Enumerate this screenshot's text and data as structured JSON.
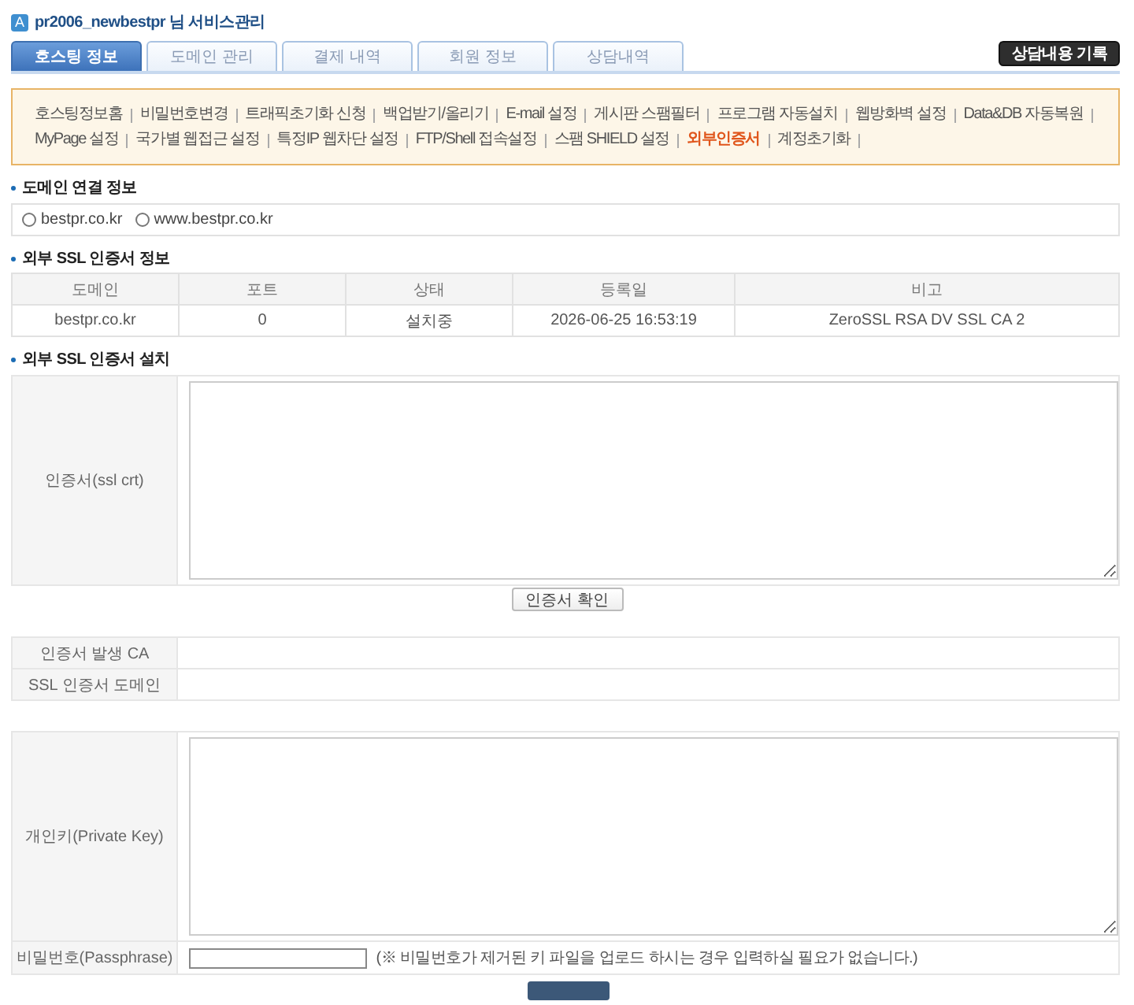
{
  "header": {
    "badge": "A",
    "title": "pr2006_newbestpr 님 서비스관리"
  },
  "tabs": [
    {
      "label": "호스팅 정보",
      "selected": true
    },
    {
      "label": "도메인 관리",
      "selected": false
    },
    {
      "label": "결제 내역",
      "selected": false
    },
    {
      "label": "회원 정보",
      "selected": false
    },
    {
      "label": "상담내역",
      "selected": false
    }
  ],
  "record_button": "상담내용 기록",
  "menu_links": [
    {
      "label": "호스팅정보홈",
      "selected": false
    },
    {
      "label": "비밀번호변경",
      "selected": false
    },
    {
      "label": "트래픽초기화 신청",
      "selected": false
    },
    {
      "label": "백업받기/올리기",
      "selected": false
    },
    {
      "label": "E-mail 설정",
      "selected": false
    },
    {
      "label": "게시판 스팸필터",
      "selected": false
    },
    {
      "label": "프로그램 자동설치",
      "selected": false
    },
    {
      "label": "웹방화벽 설정",
      "selected": false
    },
    {
      "label": "Data&DB 자동복원",
      "selected": false
    },
    {
      "label": "MyPage 설정",
      "selected": false
    },
    {
      "label": "국가별 웹접근 설정",
      "selected": false
    },
    {
      "label": "특정IP 웹차단 설정",
      "selected": false
    },
    {
      "label": "FTP/Shell 접속설정",
      "selected": false
    },
    {
      "label": "스팸 SHIELD 설정",
      "selected": false
    },
    {
      "label": "외부인증서",
      "selected": true
    },
    {
      "label": "계정초기화",
      "selected": false
    }
  ],
  "domain_connection": {
    "heading": "도메인 연결 정보",
    "options": [
      {
        "label": "bestpr.co.kr",
        "selected": false
      },
      {
        "label": "www.bestpr.co.kr",
        "selected": false
      }
    ]
  },
  "ssl_info": {
    "heading": "외부 SSL 인증서 정보",
    "table": {
      "columns": [
        "도메인",
        "포트",
        "상태",
        "등록일",
        "비고"
      ],
      "rows": [
        [
          "bestpr.co.kr",
          "0",
          "설치중",
          "2026-06-25 16:53:19",
          "ZeroSSL RSA DV SSL CA 2"
        ]
      ]
    }
  },
  "ssl_install": {
    "heading": "외부 SSL 인증서 설치",
    "certificate_label": "인증서(ssl crt)",
    "verify_button": "인증서 확인",
    "details": [
      {
        "label": "인증서 발생 CA"
      },
      {
        "label": "SSL 인증서 도메인"
      }
    ],
    "private_key_label": "개인키(Private Key)",
    "passphrase": {
      "label": "비밀번호(Passphrase)",
      "note": "(※ 비밀번호가 제거된 키 파일을 업로드 하시는 경우 입력하실 필요가 없습니다.)"
    }
  }
}
